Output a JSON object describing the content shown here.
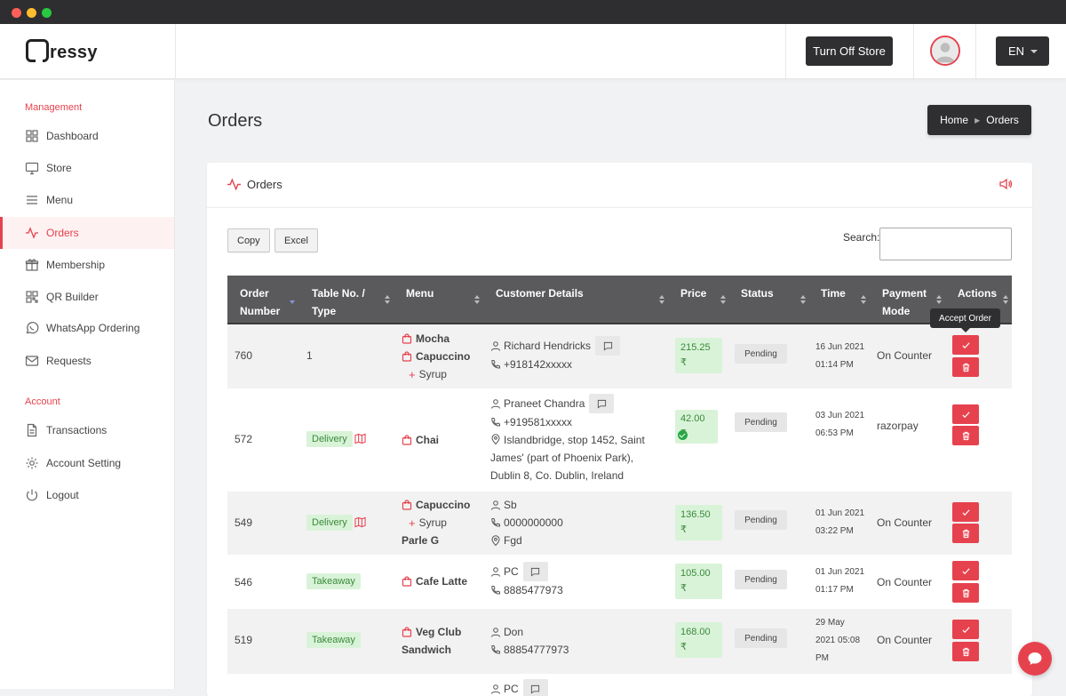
{
  "app": {
    "logo_text": "ressy"
  },
  "header": {
    "store_button": "Turn Off Store",
    "lang_button": "EN"
  },
  "sidebar": {
    "sections": [
      {
        "label": "Management"
      },
      {
        "label": "Account"
      }
    ],
    "items": [
      {
        "label": "Dashboard",
        "icon": "dashboard-icon"
      },
      {
        "label": "Store",
        "icon": "monitor-icon"
      },
      {
        "label": "Menu",
        "icon": "menu-icon"
      },
      {
        "label": "Orders",
        "icon": "pulse-icon",
        "active": true
      },
      {
        "label": "Membership",
        "icon": "gift-icon"
      },
      {
        "label": "QR Builder",
        "icon": "qr-icon"
      },
      {
        "label": "WhatsApp Ordering",
        "icon": "whatsapp-icon"
      },
      {
        "label": "Requests",
        "icon": "mail-icon"
      },
      {
        "label": "Transactions",
        "icon": "file-icon"
      },
      {
        "label": "Account Setting",
        "icon": "gear-icon"
      },
      {
        "label": "Logout",
        "icon": "power-icon"
      }
    ]
  },
  "page": {
    "title": "Orders",
    "breadcrumb": {
      "home": "Home",
      "current": "Orders"
    }
  },
  "card": {
    "title": "Orders",
    "copy_button": "Copy",
    "excel_button": "Excel",
    "search_label": "Search:",
    "search_value": ""
  },
  "table": {
    "headers": [
      {
        "line1": "Order",
        "line2": "Number"
      },
      {
        "line1": "Table No. /",
        "line2": "Type"
      },
      {
        "line1": "Menu",
        "line2": ""
      },
      {
        "line1": "Customer Details",
        "line2": ""
      },
      {
        "line1": "Price",
        "line2": ""
      },
      {
        "line1": "Status",
        "line2": ""
      },
      {
        "line1": "Time",
        "line2": ""
      },
      {
        "line1": "Payment",
        "line2": "Mode"
      },
      {
        "line1": "Actions",
        "line2": ""
      }
    ],
    "rows": [
      {
        "order": "760",
        "type": "1",
        "menu": [
          "Mocha",
          "Capuccino",
          "Syrup"
        ],
        "customer": {
          "name": "Richard Hendricks",
          "phone": "+918142xxxxx"
        },
        "price": {
          "line1": "215.25",
          "line2": "₹"
        },
        "status": "Pending",
        "time": {
          "line1": "16 Jun 2021",
          "line2": "01:14 PM"
        },
        "payment": "On Counter"
      },
      {
        "order": "572",
        "type": "Delivery",
        "menu": [
          "Chai"
        ],
        "customer": {
          "name": "Praneet Chandra",
          "phone": "+919581xxxxx",
          "address": "Islandbridge, stop 1452, Saint James' (part of Phoenix Park), Dublin 8, Co. Dublin, Ireland"
        },
        "price": {
          "line1": "42.00 ₹",
          "line2": ""
        },
        "status": "Pending",
        "time": {
          "line1": "03 Jun 2021",
          "line2": "06:53 PM"
        },
        "payment": "razorpay"
      },
      {
        "order": "549",
        "type": "Delivery",
        "menu": [
          "Capuccino",
          "Syrup",
          "Parle G"
        ],
        "customer": {
          "name": "Sb",
          "phone": "0000000000",
          "address": "Fgd"
        },
        "price": {
          "line1": "136.50",
          "line2": "₹"
        },
        "status": "Pending",
        "time": {
          "line1": "01 Jun 2021",
          "line2": "03:22 PM"
        },
        "payment": "On Counter"
      },
      {
        "order": "546",
        "type": "Takeaway",
        "menu": [
          "Cafe Latte"
        ],
        "customer": {
          "name": "PC",
          "phone": "8885477973"
        },
        "price": {
          "line1": "105.00",
          "line2": "₹"
        },
        "status": "Pending",
        "time": {
          "line1": "01 Jun 2021",
          "line2": "01:17 PM"
        },
        "payment": "On Counter"
      },
      {
        "order": "519",
        "type": "Takeaway",
        "menu": [
          "Veg Club",
          "Sandwich"
        ],
        "customer": {
          "name": "Don",
          "phone": "88854777973"
        },
        "price": {
          "line1": "168.00",
          "line2": "₹"
        },
        "status": "Pending",
        "time": {
          "line1": "29 May",
          "line2": "2021 05:08",
          "line3": "PM"
        },
        "payment": "On Counter"
      },
      {
        "customer": {
          "name": "PC"
        }
      }
    ]
  },
  "tooltip": {
    "text": "Accept Order"
  },
  "colors": {
    "accent": "#e6424e",
    "dark": "#2f2f31",
    "success_bg": "#d9f3d9",
    "success_text": "#3a8a3a"
  }
}
